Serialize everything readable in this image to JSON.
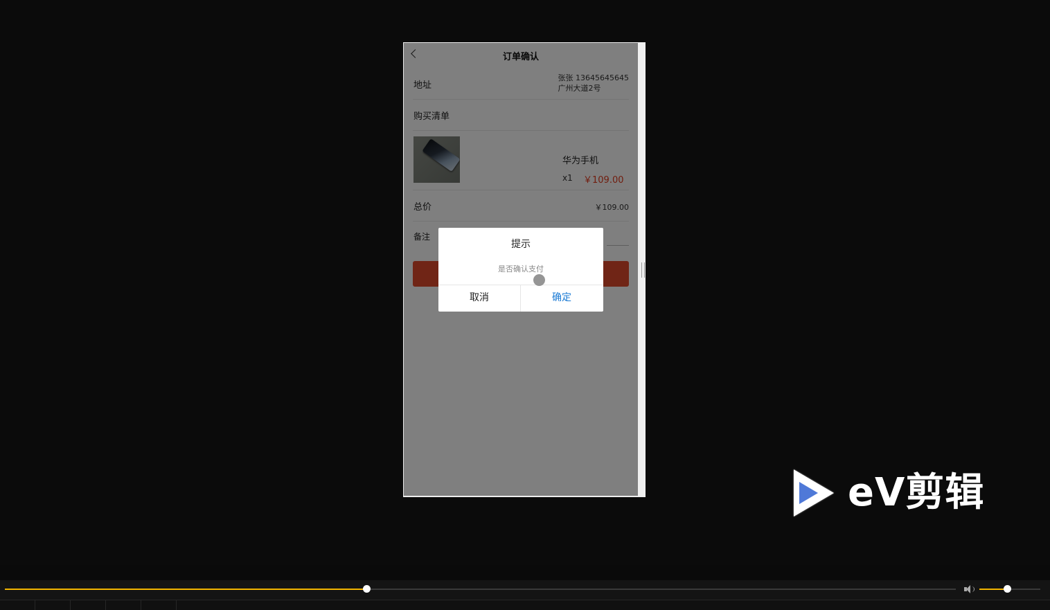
{
  "app": {
    "nav_title": "订单确认"
  },
  "order": {
    "address_label": "地址",
    "address_line1": "张张 13645645645",
    "address_line2": "广州大道2号",
    "list_label": "购买清单",
    "product_name": "华为手机",
    "product_qty": "x1",
    "product_price": "￥109.00",
    "total_label": "总价",
    "total_value": "￥109.00",
    "remark_label": "备注"
  },
  "dialog": {
    "title": "提示",
    "message": "是否确认支付",
    "cancel_label": "取消",
    "confirm_label": "确定"
  },
  "watermark": {
    "text": "eV剪辑"
  },
  "player": {
    "progress_fraction": 0.38,
    "volume_fraction": 0.45
  },
  "colors": {
    "price": "#e23a1c",
    "confirm": "#1a7ad4",
    "accent": "#f3b600"
  }
}
